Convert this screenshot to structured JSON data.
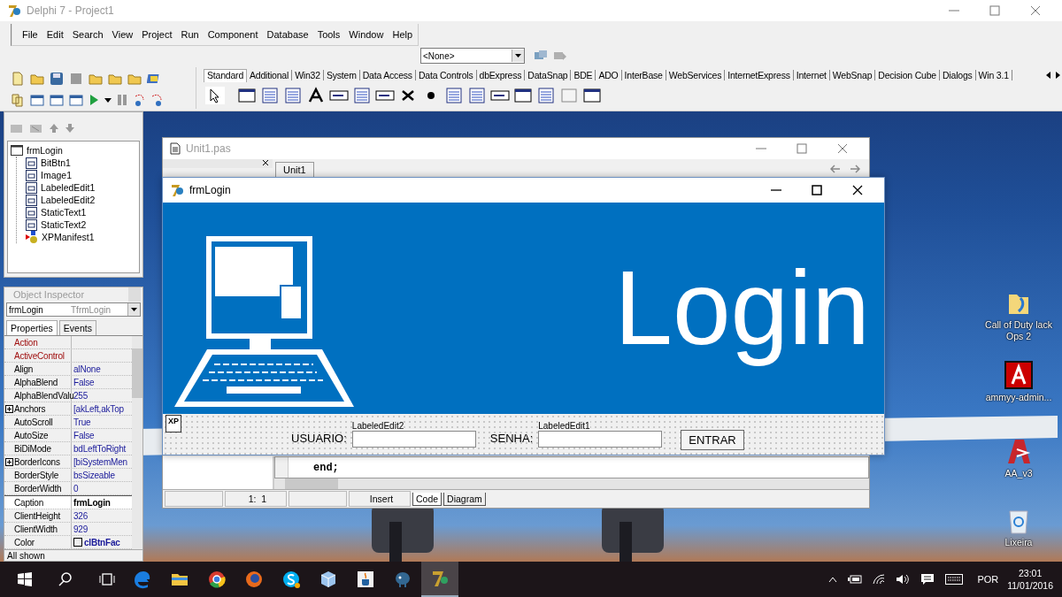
{
  "ide": {
    "title": "Delphi 7 - Project1",
    "menu": [
      "File",
      "Edit",
      "Search",
      "View",
      "Project",
      "Run",
      "Component",
      "Database",
      "Tools",
      "Window",
      "Help"
    ],
    "selector": "<None>",
    "palette_tabs": [
      {
        "label": "Standard",
        "selected": true
      },
      {
        "label": "Additional",
        "selected": false
      },
      {
        "label": "Win32",
        "selected": false
      },
      {
        "label": "System",
        "selected": false
      },
      {
        "label": "Data Access",
        "selected": false
      },
      {
        "label": "Data Controls",
        "selected": false
      },
      {
        "label": "dbExpress",
        "selected": false
      },
      {
        "label": "DataSnap",
        "selected": false
      },
      {
        "label": "BDE",
        "selected": false
      },
      {
        "label": "ADO",
        "selected": false
      },
      {
        "label": "InterBase",
        "selected": false
      },
      {
        "label": "WebServices",
        "selected": false
      },
      {
        "label": "InternetExpress",
        "selected": false
      },
      {
        "label": "Internet",
        "selected": false
      },
      {
        "label": "WebSnap",
        "selected": false
      },
      {
        "label": "Decision Cube",
        "selected": false
      },
      {
        "label": "Dialogs",
        "selected": false
      },
      {
        "label": "Win 3.1",
        "selected": false
      }
    ]
  },
  "object_tree": {
    "items": [
      {
        "label": "frmLogin",
        "kind": "form",
        "children": [
          {
            "label": "BitBtn1",
            "kind": "control"
          },
          {
            "label": "Image1",
            "kind": "control"
          },
          {
            "label": "LabeledEdit1",
            "kind": "control"
          },
          {
            "label": "LabeledEdit2",
            "kind": "control"
          },
          {
            "label": "StaticText1",
            "kind": "control"
          },
          {
            "label": "StaticText2",
            "kind": "control"
          },
          {
            "label": "XPManifest1",
            "kind": "component"
          }
        ]
      }
    ]
  },
  "object_inspector": {
    "title": "Object Inspector",
    "object": "frmLogin",
    "object_type": "TfrmLogin",
    "tabs": [
      {
        "label": "Properties",
        "selected": true
      },
      {
        "label": "Events",
        "selected": false
      }
    ],
    "properties": [
      {
        "name": "Action",
        "kind": "reference",
        "selected": false
      },
      {
        "name": "ActiveControl",
        "kind": "reference",
        "selected": false
      },
      {
        "name": "Align",
        "value": "alNone",
        "kind": "plain",
        "selected": false
      },
      {
        "name": "AlphaBlend",
        "value": "False",
        "kind": "plain",
        "selected": false
      },
      {
        "name": "AlphaBlendValu",
        "value": "255",
        "kind": "plain",
        "selected": false
      },
      {
        "name": "Anchors",
        "value": "[akLeft,akTop",
        "kind": "set",
        "selected": false
      },
      {
        "name": "AutoScroll",
        "value": "True",
        "kind": "plain",
        "selected": false
      },
      {
        "name": "AutoSize",
        "value": "False",
        "kind": "plain",
        "selected": false
      },
      {
        "name": "BiDiMode",
        "value": "bdLeftToRight",
        "kind": "plain",
        "selected": false
      },
      {
        "name": "BorderIcons",
        "value": "[biSystemMen",
        "kind": "set",
        "selected": false
      },
      {
        "name": "BorderStyle",
        "value": "bsSizeable",
        "kind": "plain",
        "selected": false
      },
      {
        "name": "BorderWidth",
        "value": "0",
        "kind": "plain",
        "selected": false
      },
      {
        "name": "Caption",
        "value": "frmLogin",
        "kind": "plain",
        "selected": true
      },
      {
        "name": "ClientHeight",
        "value": "326",
        "kind": "plain",
        "selected": false
      },
      {
        "name": "ClientWidth",
        "value": "929",
        "kind": "plain",
        "selected": false
      },
      {
        "name": "Color",
        "value": "clBtnFac",
        "kind": "color",
        "selected": false
      }
    ],
    "status": "All shown"
  },
  "editor": {
    "title": "Unit1.pas",
    "file_tab": "Unit1",
    "code_line": "end;",
    "position": "1:  1",
    "mode": "Insert",
    "view_tabs": [
      {
        "label": "Code",
        "selected": true
      },
      {
        "label": "Diagram",
        "selected": false
      }
    ]
  },
  "form": {
    "title": "frmLogin",
    "heading": "Login",
    "xp_badge": "XP",
    "fields": [
      {
        "label": "USUARIO:",
        "caption": "LabeledEdit2"
      },
      {
        "label": "SENHA:",
        "caption": "LabeledEdit1"
      }
    ],
    "button": "ENTRAR"
  },
  "desktop_icons": [
    {
      "label": "Call of Duty lack Ops 2",
      "kind": "folder"
    },
    {
      "label": "ammyy-admin...",
      "kind": "ammyy"
    },
    {
      "label": "AA_v3",
      "kind": "aa"
    },
    {
      "label": "Lixeira",
      "kind": "bin"
    }
  ],
  "taskbar": {
    "apps": [
      {
        "kind": "edge",
        "selected": false
      },
      {
        "kind": "explorer",
        "selected": false
      },
      {
        "kind": "chrome",
        "selected": false
      },
      {
        "kind": "firefox",
        "selected": false
      },
      {
        "kind": "skype",
        "selected": false
      },
      {
        "kind": "cube",
        "selected": false
      },
      {
        "kind": "java",
        "selected": false
      },
      {
        "kind": "postgres",
        "selected": false
      },
      {
        "kind": "delphi",
        "selected": true
      }
    ],
    "language": "POR",
    "time": "23:01",
    "date": "11/01/2016"
  }
}
